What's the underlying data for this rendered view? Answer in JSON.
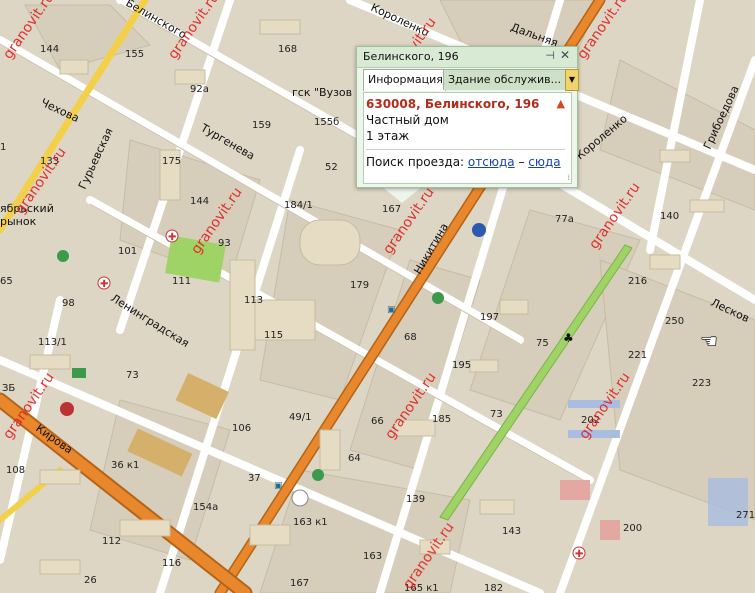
{
  "map": {
    "watermark": "granovit.ru",
    "streets": {
      "belinskogo": "Белинского",
      "korolenko_top": "Короленко",
      "korolenko": "Короленко",
      "dalnyaya": "Дальняя",
      "griboedova": "Грибоедова",
      "chekhova": "Чехова",
      "guryevskaya": "Гурьевская",
      "turgeneva": "Тургенева",
      "nikitina": "Никитина",
      "leningradskaya": "Ленинградская",
      "kirova": "Кирова",
      "leskova": "Лесков"
    },
    "places": {
      "gsk": "гск \"Вузов",
      "market1": "ябрьский",
      "market2": "рынок"
    },
    "houses": [
      "144",
      "155",
      "168",
      "92а",
      "159",
      "155б",
      "52",
      "175",
      "144",
      "184/1",
      "167",
      "93",
      "101",
      "111",
      "179",
      "113",
      "115",
      "98",
      "68",
      "197",
      "113/1",
      "73",
      "75",
      "195",
      "221",
      "223",
      "250",
      "216",
      "140",
      "77а",
      "133",
      "106",
      "49/1",
      "66",
      "185",
      "73",
      "202",
      "36 к1",
      "37",
      "64",
      "108",
      "139",
      "154а",
      "112",
      "116",
      "163 к1",
      "143",
      "200",
      "163",
      "271",
      "26",
      "167",
      "165 к1",
      "182",
      "ЗБ",
      "65",
      "1"
    ],
    "colors": {
      "ground": "#ddd6c4",
      "major_road": "#e8872c",
      "park": "#9fd365",
      "watermark": "#e02020"
    }
  },
  "popup": {
    "title": "Белинского, 196",
    "pin_icon": "pin-icon",
    "close_icon": "close-icon",
    "tab_info": "Информация",
    "tab_building": "Здание обслужив...",
    "tab_menu_icon": "chevron-down-icon",
    "address": "630008, Белинского, 196",
    "type": "Частный дом",
    "floors": "1 этаж",
    "route_label": "Поиск проезда:",
    "route_from": "отсюда",
    "route_dash": "–",
    "route_to": "сюда"
  }
}
